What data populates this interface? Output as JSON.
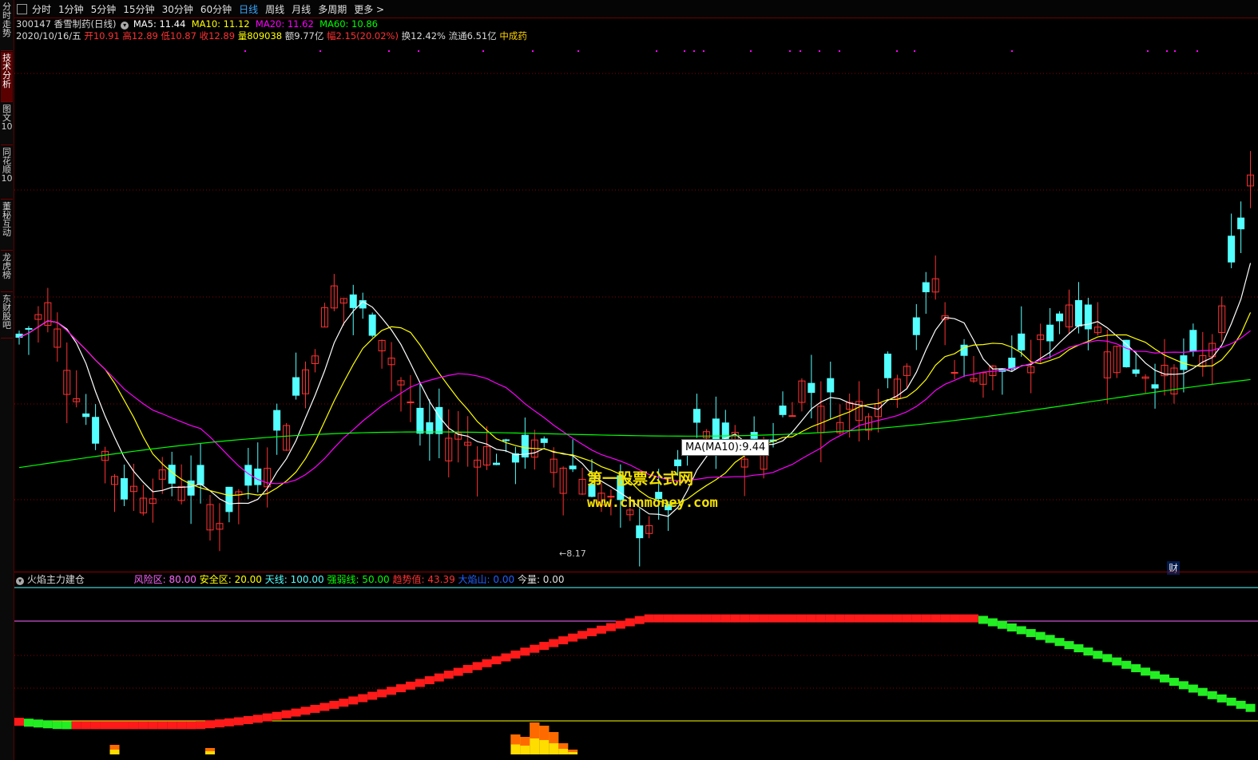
{
  "sidebar": {
    "tabs": [
      {
        "label": "分时走势",
        "active": false
      },
      {
        "label": "技术分析",
        "active": true
      },
      {
        "label": "图文10",
        "active": false
      },
      {
        "label": "同花顺10",
        "active": false
      },
      {
        "label": "董秘互动",
        "active": false
      },
      {
        "label": "龙虎榜",
        "active": false
      },
      {
        "label": "东财股吧",
        "active": false
      }
    ]
  },
  "toolbar": {
    "periods": [
      {
        "label": "分时",
        "active": false
      },
      {
        "label": "1分钟",
        "active": false
      },
      {
        "label": "5分钟",
        "active": false
      },
      {
        "label": "15分钟",
        "active": false
      },
      {
        "label": "30分钟",
        "active": false
      },
      {
        "label": "60分钟",
        "active": false
      },
      {
        "label": "日线",
        "active": true
      },
      {
        "label": "周线",
        "active": false
      },
      {
        "label": "月线",
        "active": false
      },
      {
        "label": "多周期",
        "active": false
      }
    ],
    "more_label": "更多 >"
  },
  "stock": {
    "title": "300147 香雪制药(日线)",
    "ma5": "MA5: 11.44",
    "ma10": "MA10: 11.12",
    "ma20": "MA20: 11.62",
    "ma60": "MA60: 10.86",
    "date": "2020/10/16/五",
    "open": "开10.91",
    "high": "高12.89",
    "low": "低10.87",
    "close": "收12.89",
    "vol": "量809038",
    "amount": "额9.77亿",
    "change": "幅2.15(20.02%)",
    "turnover": "换12.42%",
    "float": "流通6.51亿",
    "sector": "中成药"
  },
  "colors": {
    "up": "#ff3232",
    "down": "#54ffff",
    "ma5": "#ffffff",
    "ma10": "#ffff00",
    "ma20": "#ff00ff",
    "ma60": "#00ff00"
  },
  "tooltip": "MA(MA10):9.44",
  "watermark": {
    "line1": "第一股票公式网",
    "line2": "www.chnmoney.com"
  },
  "low_label": "←8.17",
  "cai_label": "财",
  "indicator": {
    "name": "火焰主力建仓",
    "risk": "风险区: 80.00",
    "safe": "安全区: 20.00",
    "sky": "天线: 100.00",
    "strong": "强弱线: 50.00",
    "trend": "趋势值: 43.39",
    "flame": "大焰山: 0.00",
    "vol": "今量: 0.00"
  }
}
